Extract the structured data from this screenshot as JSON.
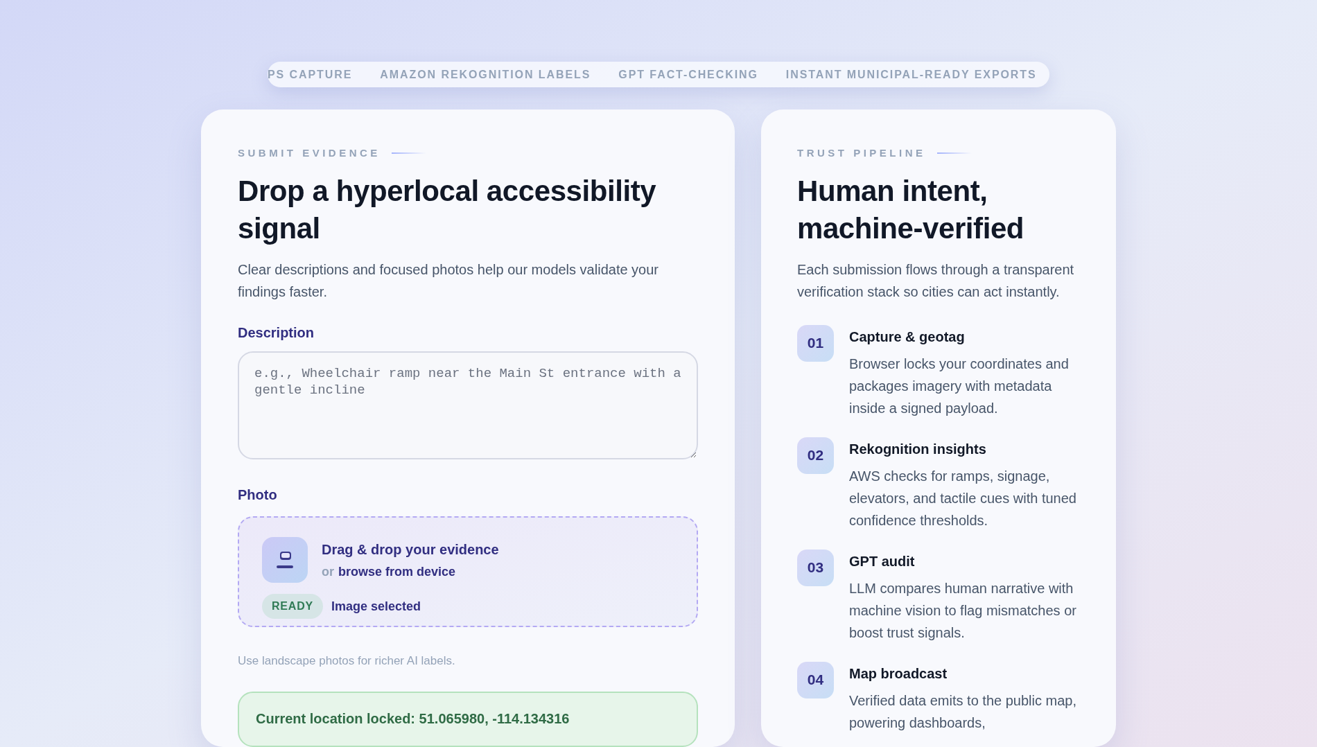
{
  "feature_strip": [
    "PS CAPTURE",
    "AMAZON REKOGNITION LABELS",
    "GPT FACT-CHECKING",
    "INSTANT MUNICIPAL-READY EXPORTS"
  ],
  "submit_card": {
    "eyebrow": "SUBMIT EVIDENCE",
    "title": "Drop a hyperlocal accessibility signal",
    "intro": "Clear descriptions and focused photos help our models validate your findings faster.",
    "description": {
      "label": "Description",
      "placeholder": "e.g., Wheelchair ramp near the Main St entrance with a gentle incline"
    },
    "photo": {
      "label": "Photo",
      "headline": "Drag & drop your evidence",
      "or": "or",
      "browse_link": "browse from device",
      "status_badge": "READY",
      "status_text": "Image selected",
      "hint": "Use landscape photos for richer AI labels."
    },
    "location": "Current location locked: 51.065980, -114.134316"
  },
  "pipeline_card": {
    "eyebrow": "TRUST PIPELINE",
    "title": "Human intent, machine-verified",
    "intro": "Each submission flows through a transparent verification stack so cities can act instantly.",
    "steps": [
      {
        "number": "01",
        "title": "Capture & geotag",
        "text": "Browser locks your coordinates and packages imagery with metadata inside a signed payload."
      },
      {
        "number": "02",
        "title": "Rekognition insights",
        "text": "AWS checks for ramps, signage, elevators, and tactile cues with tuned confidence thresholds."
      },
      {
        "number": "03",
        "title": "GPT audit",
        "text": "LLM compares human narrative with machine vision to flag mismatches or boost trust signals."
      },
      {
        "number": "04",
        "title": "Map broadcast",
        "text": "Verified data emits to the public map, powering dashboards,"
      }
    ]
  }
}
